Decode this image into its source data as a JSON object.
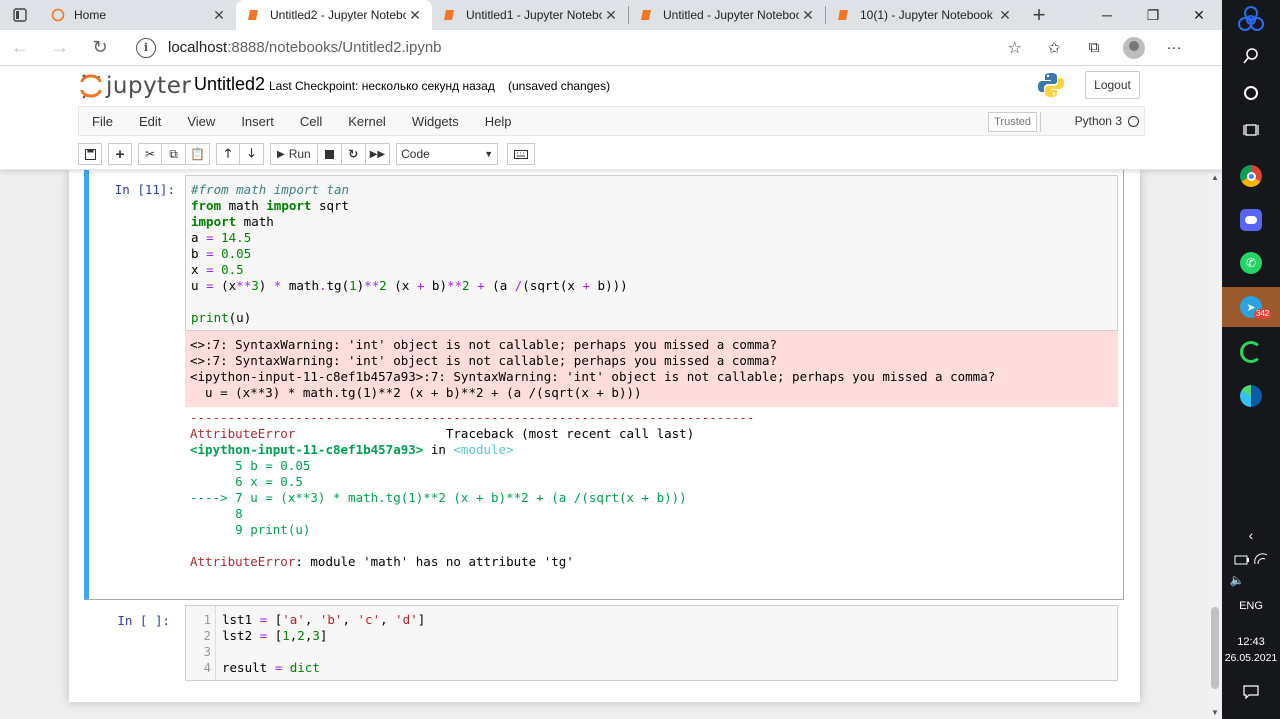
{
  "browser": {
    "tabs": [
      {
        "title": "Home",
        "active": false
      },
      {
        "title": "Untitled2 - Jupyter Notebo",
        "active": true
      },
      {
        "title": "Untitled1 - Jupyter Notebo",
        "active": false
      },
      {
        "title": "Untitled - Jupyter Noteboo",
        "active": false
      },
      {
        "title": "10(1) - Jupyter Notebook",
        "active": false
      }
    ],
    "url_host": "localhost",
    "url_path": ":8888/notebooks/Untitled2.ipynb"
  },
  "jupyter": {
    "logo_text": "jupyter",
    "notebook_name": "Untitled2",
    "checkpoint": "Last Checkpoint: несколько секунд назад",
    "unsaved": "(unsaved changes)",
    "logout_label": "Logout",
    "menu": [
      "File",
      "Edit",
      "View",
      "Insert",
      "Cell",
      "Kernel",
      "Widgets",
      "Help"
    ],
    "trusted_label": "Trusted",
    "kernel_name": "Python 3",
    "run_label": "Run",
    "cell_type": "Code"
  },
  "cell1": {
    "prompt": "In [11]:",
    "code": [
      "#from math import tan",
      "from math import sqrt",
      "import math",
      "a = 14.5",
      "b = 0.05",
      "x = 0.5",
      "u = (x**3) * math.tg(1)**2 (x + b)**2 + (a /(sqrt(x + b)))",
      "",
      "print(u)"
    ],
    "stderr": [
      "<>:7: SyntaxWarning: 'int' object is not callable; perhaps you missed a comma?",
      "<>:7: SyntaxWarning: 'int' object is not callable; perhaps you missed a comma?",
      "<ipython-input-11-c8ef1b457a93>:7: SyntaxWarning: 'int' object is not callable; perhaps you missed a comma?",
      "  u = (x**3) * math.tg(1)**2 (x + b)**2 + (a /(sqrt(x + b)))"
    ],
    "traceback": {
      "rule": "---------------------------------------------------------------------------",
      "error_name": "AttributeError",
      "traceback_header": "Traceback (most recent call last)",
      "input_ref": "<ipython-input-11-c8ef1b457a93>",
      "in_word": " in ",
      "module_ref": "<module>",
      "lines": [
        "      5 b = 0.05",
        "      6 x = 0.5",
        "----> 7 u = (x**3) * math.tg(1)**2 (x + b)**2 + (a /(sqrt(x + b)))",
        "      8 ",
        "      9 print(u)"
      ],
      "final_name": "AttributeError",
      "final_msg": ": module 'math' has no attribute 'tg'"
    }
  },
  "cell2": {
    "prompt": "In [ ]:",
    "line_numbers": [
      "1",
      "2",
      "3",
      "4"
    ],
    "code": [
      "lst1 = ['a', 'b', 'c', 'd']",
      "lst2 = [1,2,3]",
      "",
      "result = dict"
    ]
  },
  "taskbar": {
    "lang": "ENG",
    "time": "12:43",
    "date": "26.05.2021",
    "telegram_badge": "342"
  }
}
